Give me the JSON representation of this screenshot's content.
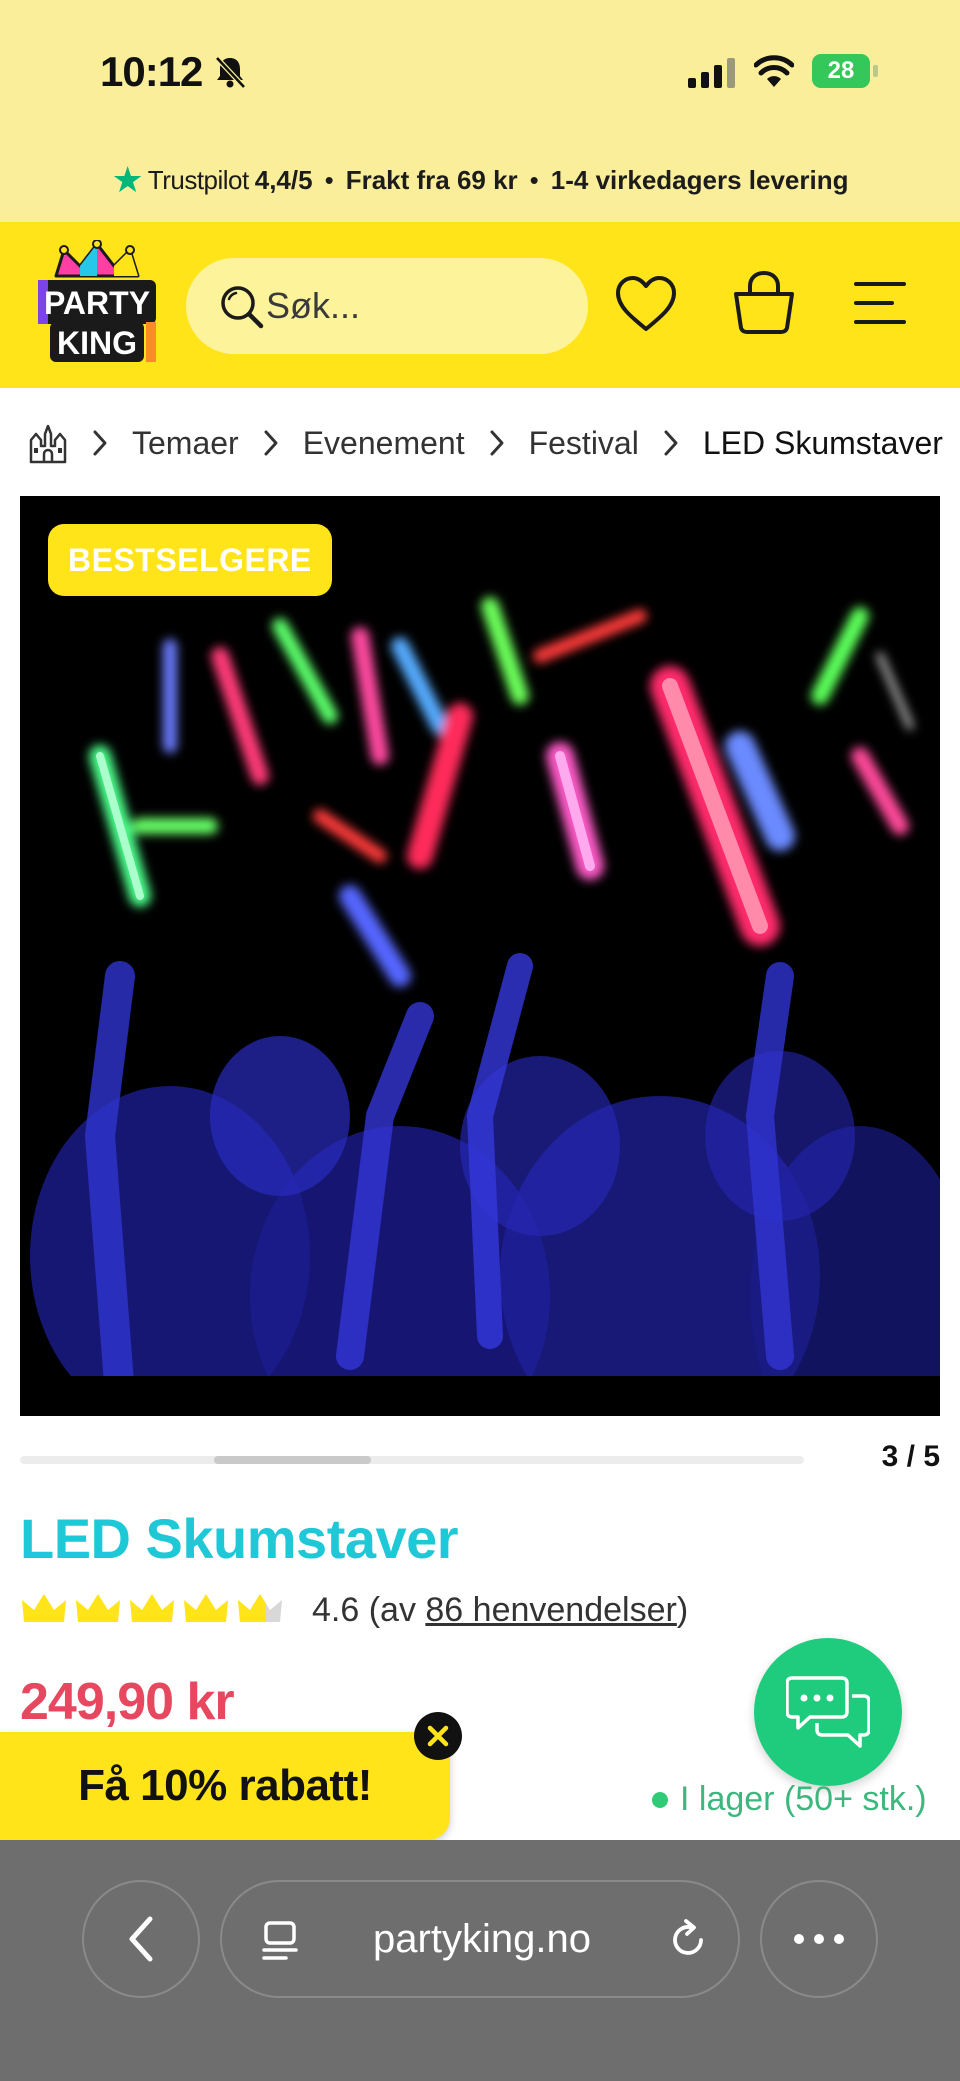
{
  "status_bar": {
    "time": "10:12",
    "battery": "28",
    "icons": [
      "bell-slash-icon",
      "cellular-signal-icon",
      "wifi-icon",
      "battery-charging-icon"
    ]
  },
  "promo_bar": {
    "trustpilot_label": "Trustpilot",
    "trustpilot_score": "4,4/5",
    "separator": "•",
    "shipping": "Frakt fra 69 kr",
    "delivery": "1-4 virkedagers levering"
  },
  "header": {
    "logo_alt": "Party King",
    "search_placeholder": "Søk...",
    "icons": [
      "search-icon",
      "heart-icon",
      "bag-icon",
      "menu-icon"
    ]
  },
  "breadcrumb": {
    "items": [
      "Temaer",
      "Evenement",
      "Festival",
      "LED Skumstaver"
    ]
  },
  "gallery": {
    "badge": "BESTSELGERE",
    "counter": "3 / 5",
    "current_index": 3,
    "total": 5
  },
  "product": {
    "title": "LED Skumstaver",
    "rating_value": 4.6,
    "rating_text_prefix": "4.6 (av ",
    "rating_count_link": "86 henvendelser",
    "rating_text_suffix": ")",
    "price": "249,90 kr",
    "stock": "I lager (50+ stk.)"
  },
  "popup": {
    "discount_label": "Få 10% rabatt!"
  },
  "browser": {
    "url": "partyking.no",
    "icons": [
      "back-chevron-icon",
      "reader-icon",
      "reload-icon",
      "more-icon"
    ]
  },
  "colors": {
    "accent_yellow": "#ffe419",
    "promo_yellow": "#fbee9a",
    "title_cyan": "#1fc8d6",
    "price_red": "#e8485f",
    "chat_green": "#1fcb7d",
    "trustpilot_green": "#00b67a"
  }
}
